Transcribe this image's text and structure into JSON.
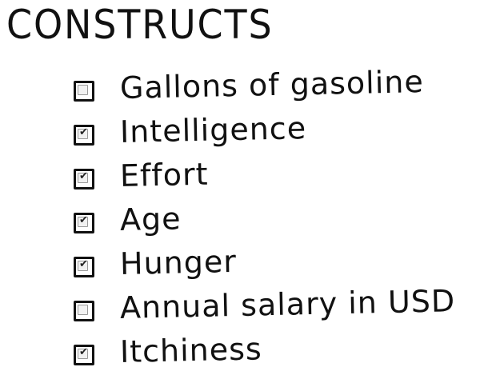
{
  "title": "CONSTRUCTS",
  "items": [
    {
      "label": "Gallons of gasoline",
      "checked": false
    },
    {
      "label": "Intelligence",
      "checked": true
    },
    {
      "label": "Effort",
      "checked": true
    },
    {
      "label": "Age",
      "checked": true
    },
    {
      "label": "Hunger",
      "checked": true
    },
    {
      "label": "Annual salary in USD",
      "checked": false
    },
    {
      "label": "Itchiness",
      "checked": true
    }
  ]
}
